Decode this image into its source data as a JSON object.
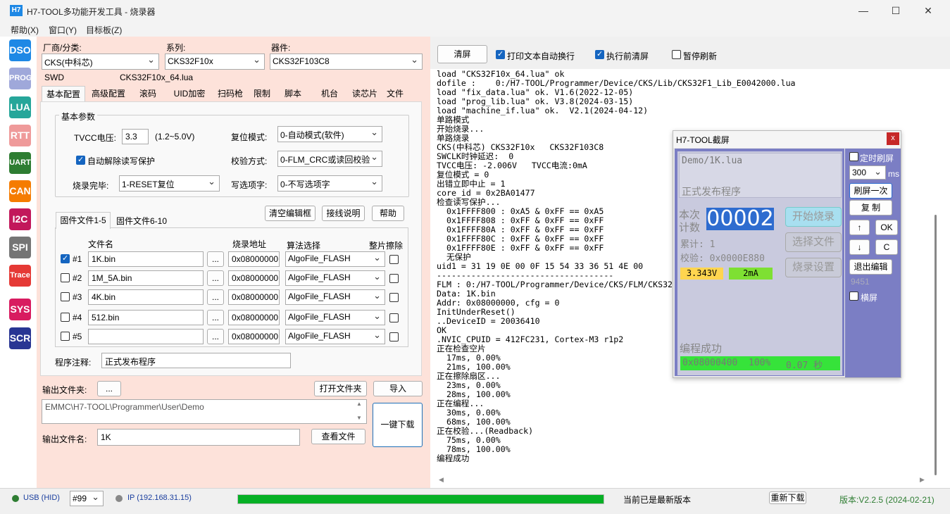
{
  "window": {
    "app_icon": "H7",
    "title": "H7-TOOL多功能开发工具 - 烧录器",
    "min": "—",
    "max": "☐",
    "close": "✕"
  },
  "menu": [
    "帮助(X)",
    "窗口(Y)",
    "目标板(Z)"
  ],
  "sidebar": [
    {
      "label": "DSO",
      "color": "#1e88e5"
    },
    {
      "label": "PROG",
      "color": "#9fa8da"
    },
    {
      "label": "LUA",
      "color": "#26a69a"
    },
    {
      "label": "RTT",
      "color": "#ef9a9a"
    },
    {
      "label": "UART",
      "color": "#2e7d32"
    },
    {
      "label": "CAN",
      "color": "#f57c00"
    },
    {
      "label": "I2C",
      "color": "#c2185b"
    },
    {
      "label": "SPI",
      "color": "#757575"
    },
    {
      "label": "Trace",
      "color": "#e53935"
    },
    {
      "label": "SYS",
      "color": "#d81b60"
    },
    {
      "label": "SCR",
      "color": "#283593"
    }
  ],
  "config": {
    "vendor_label": "厂商/分类:",
    "vendor_value": "CKS(中科芯)",
    "series_label": "系列:",
    "series_value": "CKS32F10x",
    "device_label": "器件:",
    "device_value": "CKS32F103C8",
    "iface": "SWD",
    "lua_file": "CKS32F10x_64.lua",
    "tabs": [
      "基本配置",
      "高级配置",
      "滚码",
      "UID加密",
      "扫码枪",
      "限制",
      "脚本",
      "机台",
      "读芯片",
      "文件"
    ],
    "group_title": "基本参数",
    "tvcc_label": "TVCC电压:",
    "tvcc_value": "3.3",
    "tvcc_range": "(1.2~5.0V)",
    "reset_label": "复位模式:",
    "reset_value": "0-自动模式(软件)",
    "auto_unprotect": "自动解除读写保护",
    "verify_label": "校验方式:",
    "verify_value": "0-FLM_CRC或读回校验",
    "done_label": "烧录完毕:",
    "done_value": "1-RESET复位",
    "option_label": "写选项字:",
    "option_value": "0-不写选项字",
    "clear_btn": "清空编辑框",
    "wiring_btn": "接线说明",
    "help_btn": "帮助",
    "file_tabs": [
      "固件文件1-5",
      "固件文件6-10"
    ],
    "col_file": "文件名",
    "col_addr": "烧录地址",
    "col_algo": "算法选择",
    "col_erase": "整片擦除",
    "rows": [
      {
        "no": "#1",
        "file": "1K.bin",
        "addr": "0x08000000",
        "algo": "AlgoFile_FLASH",
        "checked": true
      },
      {
        "no": "#2",
        "file": "1M_5A.bin",
        "addr": "0x08000000",
        "algo": "AlgoFile_FLASH",
        "checked": false
      },
      {
        "no": "#3",
        "file": "4K.bin",
        "addr": "0x08000000",
        "algo": "AlgoFile_FLASH",
        "checked": false
      },
      {
        "no": "#4",
        "file": "512.bin",
        "addr": "0x08000000",
        "algo": "AlgoFile_FLASH",
        "checked": false
      },
      {
        "no": "#5",
        "file": "",
        "addr": "0x08000000",
        "algo": "AlgoFile_FLASH",
        "checked": false
      }
    ],
    "browse": "...",
    "note_label": "程序注释:",
    "note_value": "正式发布程序",
    "out_dir_label": "输出文件夹:",
    "out_dir_btn": "...",
    "open_dir_btn": "打开文件夹",
    "import_btn": "导入",
    "out_path": "EMMC\\H7-TOOL\\Programmer\\User\\Demo",
    "download_btn": "一键下载",
    "out_name_label": "输出文件名:",
    "out_name_value": "1K",
    "view_file_btn": "查看文件"
  },
  "log_toolbar": {
    "clear": "清屏",
    "autowrap": "打印文本自动换行",
    "clear_before": "执行前清屏",
    "pause": "暂停刷新"
  },
  "log": [
    "load \"CKS32F10x_64.lua\" ok",
    "dofile :    0:/H7-TOOL/Programmer/Device/CKS/Lib/CKS32F1_Lib_E0042000.lua",
    "load \"fix_data.lua\" ok. V1.6(2022-12-05)",
    "load \"prog_lib.lua\" ok. V3.8(2024-03-15)",
    "load \"machine_if.lua\" ok.  V2.1(2024-04-12)",
    "单路模式",
    "开始烧录...",
    "单路烧录",
    "CKS(中科芯) CKS32F10x   CKS32F103C8",
    "SWCLK时钟延迟:  0",
    "TVCC电压: -2.006V   TVCC电流:0mA",
    "复位模式 = 0",
    "出错立即中止 = 1",
    "core_id = 0x2BA01477",
    "检查读写保护...",
    "  0x1FFFF800 : 0xA5 & 0xFF == 0xA5",
    "  0x1FFFF808 : 0xFF & 0xFF == 0xFF",
    "  0x1FFFF80A : 0xFF & 0xFF == 0xFF",
    "  0x1FFFF80C : 0xFF & 0xFF == 0xFF",
    "  0x1FFFF80E : 0xFF & 0xFF == 0xFF",
    "  无保护",
    "uid1 = 31 19 0E 00 0F 15 54 33 36 51 4E 00",
    "------------------------------------",
    "FLM : 0:/H7-TOOL/Programmer/Device/CKS/FLM/CKS32",
    "Data: 1K.bin",
    "Addr: 0x08000000, cfg = 0",
    "InitUnderReset()",
    "..DeviceID = 20036410",
    "OK",
    ".NVIC_CPUID = 412FC231, Cortex-M3 r1p2",
    "正在检查空片",
    "  17ms, 0.00%",
    "  21ms, 100.00%",
    "正在擦除扇区...",
    "  23ms, 0.00%",
    "  28ms, 100.00%",
    "正在编程...",
    "  30ms, 0.00%",
    "  68ms, 100.00%",
    "正在校验...(Readback)",
    "  75ms, 0.00%",
    "  78ms, 100.00%",
    "编程成功"
  ],
  "screen": {
    "title": "H7-TOOL截屏",
    "close": "x",
    "lua": "Demo/1K.lua",
    "note": "正式发布程序",
    "count_label1": "本次",
    "count_label2": "计数",
    "count": "00002",
    "total": "累计: 1",
    "checksum": "校验: 0x0000E880",
    "voltage": "3.343V",
    "current": "2mA",
    "btn_start": "开始烧录",
    "btn_select": "选择文件",
    "btn_settings": "烧录设置",
    "status": "编程成功",
    "progress_addr": "0x08000400",
    "progress_pct": "100%",
    "progress_time": "0.07 秒",
    "timer_label": "定时刷屏",
    "interval": "300",
    "ms": "ms",
    "refresh_btn": "刷屏一次",
    "copy_btn": "复 制",
    "up": "↑",
    "ok": "OK",
    "down": "↓",
    "c": "C",
    "exit_btn": "退出编辑",
    "code": "9451",
    "landscape": "横屏"
  },
  "status": {
    "usb": "USB (HID)",
    "port": "#99",
    "ip": "IP (192.168.31.15)",
    "progress": 1.0,
    "msg": "当前已是最新版本",
    "redownload": "重新下载",
    "version": "版本:V2.2.5 (2024-02-21)"
  }
}
